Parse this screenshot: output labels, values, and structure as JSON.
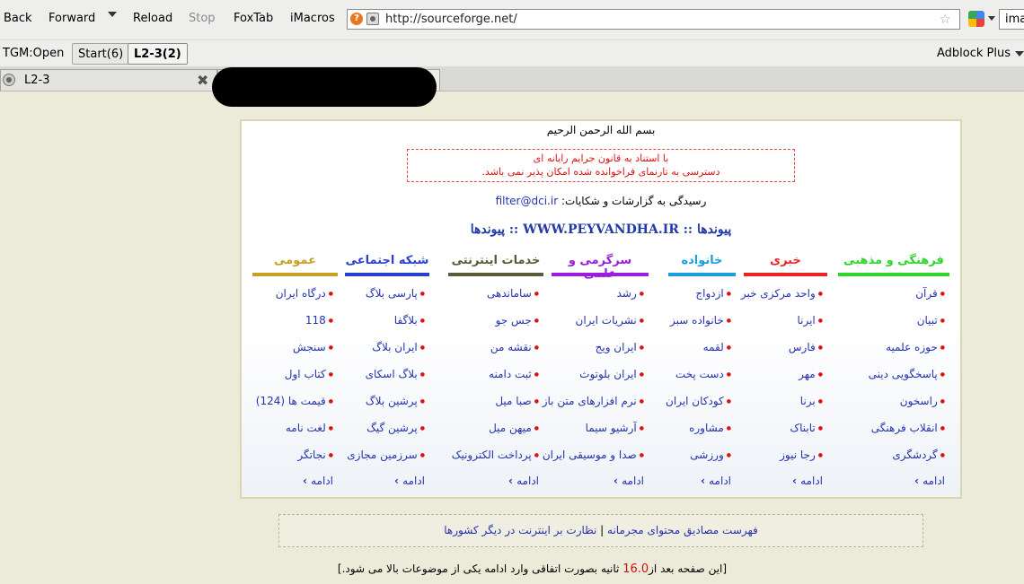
{
  "nav": {
    "back": "Back",
    "forward": "Forward",
    "reload": "Reload",
    "stop": "Stop",
    "foxtab": "FoxTab",
    "imacros": "iMacros",
    "url": "http://sourceforge.net/",
    "search_value": "ima"
  },
  "tgm": {
    "label": "TGM:Open",
    "groups": [
      "Start(6)",
      "L2-3(2)"
    ],
    "adblock": "Adblock Plus"
  },
  "tabs": [
    {
      "title": "L2-3"
    }
  ],
  "page": {
    "bism": "بسم الله الرحمن الرحیم",
    "notice_line1": "با استناد به قانون جرایم رایانه ای",
    "notice_line2": "دسترسی به تارنمای فراخوانده شده امکان پذیر نمی باشد.",
    "report_label": "رسیدگی به گزارشات و شکایات:",
    "report_email": "filter@dci.ir",
    "brand": "پیوندها :: WWW.PEYVANDHA.IR :: پیوندها",
    "more_label": "ادامه",
    "columns": [
      {
        "title": "فرهنگی و مذهبی",
        "color": "#2cd62c",
        "items": [
          "قرآن",
          "تبیان",
          "حوزه علمیه",
          "پاسخگویی دینی",
          "راسخون",
          "انقلاب فرهنگی",
          "گردشگری"
        ]
      },
      {
        "title": "خبری",
        "color": "#ee2222",
        "items": [
          "واحد مرکزی خبر",
          "ایرنا",
          "فارس",
          "مهر",
          "برنا",
          "تابناک",
          "رجا نیوز"
        ]
      },
      {
        "title": "خانواده",
        "color": "#1a9ee0",
        "items": [
          "ازدواج",
          "خانواده سبز",
          "لقمه",
          "دست پخت",
          "کودکان ایران",
          "مشاوره",
          "ورزشی"
        ]
      },
      {
        "title": "سرگرمی و علمی",
        "color": "#9b1ee0",
        "items": [
          "رشد",
          "نشریات ایران",
          "ایران ویج",
          "ایران بلوتوث",
          "نرم افزارهای متن باز",
          "آرشیو سیما",
          "صدا و موسیقی ایران"
        ]
      },
      {
        "title": "خدمات اینترنتی",
        "color": "#5a5a3a",
        "items": [
          "ساماندهی",
          "جس جو",
          "نقشه من",
          "ثبت دامنه",
          "صبا میل",
          "میهن میل",
          "پرداخت الکترونیک"
        ]
      },
      {
        "title": "شبکه اجتماعی",
        "color": "#2a3fd0",
        "items": [
          "پارسی بلاگ",
          "بلاگفا",
          "ایران بلاگ",
          "بلاگ اسکای",
          "پرشین بلاگ",
          "پرشین گیگ",
          "سرزمین مجازی"
        ]
      },
      {
        "title": "عمومی",
        "color": "#c8a020",
        "items": [
          "درگاه ایران",
          "118",
          "سنجش",
          "کتاب اول",
          "قیمت ها (124)",
          "لغت نامه",
          "نجاتگر"
        ]
      }
    ],
    "bottom_link1": "فهرست مصادیق محتوای مجرمانه",
    "bottom_separator": "|",
    "bottom_link2": "نظارت بر اینترنت در دیگر کشورها",
    "timer_before": "[این صفحه بعد از",
    "timer_count": "16.0",
    "timer_after": "ثانیه بصورت اتفاقی وارد ادامه یکی از موضوعات بالا می شود.]"
  }
}
